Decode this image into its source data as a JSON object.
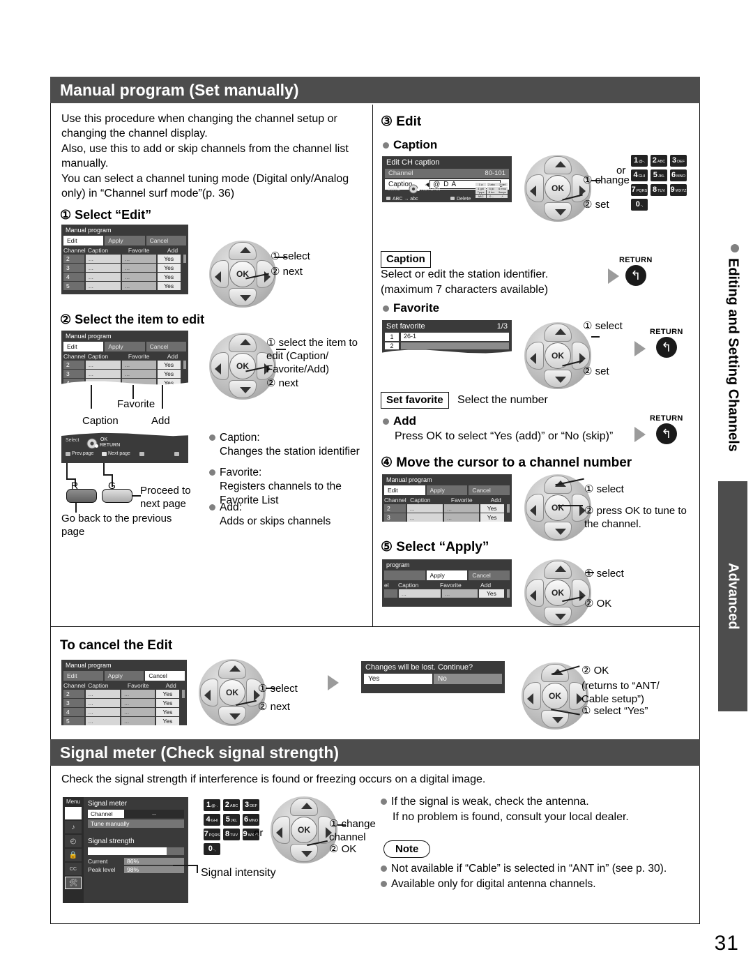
{
  "page_number": "31",
  "side_tabs": {
    "chapter": "Editing and Setting Channels",
    "level": "Advanced"
  },
  "section_manual": {
    "heading": "Manual program (Set manually)",
    "intro": [
      "Use this procedure when changing the channel setup or changing the channel display.",
      "Also, use this to add or skip channels from the channel list manually.",
      "You can select a channel tuning mode (Digital only/Analog only) in “Channel surf mode”(p. 36)"
    ],
    "step1": {
      "title": "① Select “Edit”",
      "screen": {
        "title": "Manual program",
        "tabs": [
          "Edit",
          "Apply",
          "Cancel"
        ],
        "selected_tab": "Edit",
        "columns": [
          "Channel",
          "Caption",
          "Favorite",
          "Add"
        ],
        "rows": [
          {
            "channel": "2",
            "caption": "...",
            "favorite": "...",
            "add": "Yes"
          },
          {
            "channel": "3",
            "caption": "...",
            "favorite": "...",
            "add": "Yes"
          },
          {
            "channel": "4",
            "caption": "...",
            "favorite": "...",
            "add": "Yes"
          },
          {
            "channel": "5",
            "caption": "...",
            "favorite": "...",
            "add": "Yes"
          }
        ]
      },
      "callouts": [
        "① select",
        "② next"
      ]
    },
    "step2": {
      "title": "② Select the item to edit",
      "screen": {
        "title": "Manual program",
        "tabs": [
          "Edit",
          "Apply",
          "Cancel"
        ],
        "selected_tab": "Edit",
        "columns": [
          "Channel",
          "Caption",
          "Favorite",
          "Add"
        ],
        "rows": [
          {
            "channel": "2",
            "caption": "...",
            "favorite": "...",
            "add": "Yes"
          },
          {
            "channel": "3",
            "caption": "...",
            "favorite": "...",
            "add": "Yes"
          },
          {
            "channel": "4",
            "caption": "...",
            "favorite": "...",
            "add": "Yes"
          }
        ]
      },
      "pointer_labels": {
        "caption": "Caption",
        "favorite": "Favorite",
        "add": "Add"
      },
      "callouts": [
        "① select the item to edit (Caption/ Favorite/Add)",
        "② next"
      ],
      "guide_bar": {
        "select": "Select",
        "ok": "OK",
        "return": "RETURN",
        "prev_page": "Prev.page",
        "next_page": "Next page"
      },
      "color_buttons": {
        "r_label": "R",
        "g_label": "G",
        "r_desc": "Go back to the previous page",
        "g_desc": "Proceed to next page"
      },
      "definitions": [
        {
          "term": "Caption:",
          "desc": "Changes the station identifier"
        },
        {
          "term": "Favorite:",
          "desc": "Registers channels to the Favorite List"
        },
        {
          "term": "Add:",
          "desc": "Adds or skips channels"
        }
      ]
    },
    "step3": {
      "title": "③ Edit",
      "caption_sub": "Caption",
      "caption_screen": {
        "title": "Edit CH caption",
        "channel_label": "Channel",
        "channel_value": "80-101",
        "caption_label": "Caption",
        "caption_value": "@ D A",
        "guide_select": "Select",
        "guide_ok": "OK",
        "guide_return": "RETURN",
        "guide_case": "ABC → abc",
        "guide_delete": "Delete"
      },
      "callouts": [
        "① change",
        "② set"
      ],
      "or_label": "or",
      "keypad": [
        {
          "num": "1",
          "sub": "@-."
        },
        {
          "num": "2",
          "sub": "ABC"
        },
        {
          "num": "3",
          "sub": "DEF"
        },
        {
          "num": "4",
          "sub": "GHI"
        },
        {
          "num": "5",
          "sub": "JKL"
        },
        {
          "num": "6",
          "sub": "MNO"
        },
        {
          "num": "7",
          "sub": "PQRS"
        },
        {
          "num": "8",
          "sub": "TUV"
        },
        {
          "num": "9",
          "sub": "WXYZ"
        },
        {
          "num": "0",
          "sub": "-,"
        }
      ],
      "return_label": "RETURN",
      "caption_box": "Caption",
      "caption_desc1": "Select or edit the station identifier.",
      "caption_desc2": "(maximum 7 characters available)",
      "favorite_sub": "Favorite",
      "favorite_screen": {
        "title": "Set favorite",
        "page": "1/3",
        "rows": [
          {
            "index": "1",
            "value": "26-1"
          },
          {
            "index": "2",
            "value": ""
          }
        ]
      },
      "favorite_callouts": [
        "① select",
        "② set"
      ],
      "setfav_box": "Set favorite",
      "setfav_desc": "Select the number",
      "add_sub": "Add",
      "add_desc": "Press OK to select “Yes (add)” or “No (skip)”"
    },
    "step4": {
      "title": "④ Move the cursor to a channel number",
      "screen": {
        "title": "Manual program",
        "tabs": [
          "Edit",
          "Apply",
          "Cancel"
        ],
        "selected_tab": "Edit",
        "columns": [
          "Channel",
          "Caption",
          "Favorite",
          "Add"
        ],
        "rows": [
          {
            "channel": "2",
            "caption": "...",
            "favorite": "...",
            "add": "Yes"
          },
          {
            "channel": "3",
            "caption": "...",
            "favorite": "...",
            "add": "Yes"
          }
        ]
      },
      "callouts": [
        "① select",
        "② press OK to tune to the channel."
      ]
    },
    "step5": {
      "title": "⑤ Select “Apply”",
      "screen": {
        "title": "program",
        "tabs": [
          "",
          "Apply",
          "Cancel"
        ],
        "selected_tab": "Apply",
        "columns": [
          "el",
          "Caption",
          "Favorite",
          "Add"
        ],
        "rows": [
          {
            "channel": "",
            "caption": "...",
            "favorite": "...",
            "add": "Yes"
          }
        ]
      },
      "callouts": [
        "① select",
        "② OK"
      ]
    },
    "cancel": {
      "title": "To cancel the Edit",
      "screen": {
        "title": "Manual program",
        "tabs": [
          "Edit",
          "Apply",
          "Cancel"
        ],
        "selected_tab": "Cancel",
        "columns": [
          "Channel",
          "Caption",
          "Favorite",
          "Add"
        ],
        "rows": [
          {
            "channel": "2",
            "caption": "...",
            "favorite": "...",
            "add": "Yes"
          },
          {
            "channel": "3",
            "caption": "...",
            "favorite": "...",
            "add": "Yes"
          },
          {
            "channel": "4",
            "caption": "...",
            "favorite": "...",
            "add": "Yes"
          },
          {
            "channel": "5",
            "caption": "...",
            "favorite": "...",
            "add": "Yes"
          }
        ]
      },
      "callouts1": [
        "① select",
        "② next"
      ],
      "dialog": {
        "message": "Changes will be lost. Continue?",
        "yes": "Yes",
        "no": "No"
      },
      "callouts2": [
        "② OK",
        "(returns to “ANT/ Cable setup”)",
        "① select “Yes”"
      ]
    }
  },
  "section_signal": {
    "heading": "Signal meter (Check signal strength)",
    "intro": "Check the signal strength if interference is found or freezing occurs on a digital image.",
    "screen": {
      "menu_label": "Menu",
      "title": "Signal meter",
      "channel_label": "Channel",
      "channel_value": "--",
      "tune_manually": "Tune manually",
      "strength_label": "Signal strength",
      "current_label": "Current",
      "current_value": "86%",
      "peak_label": "Peak level",
      "peak_value": "98%",
      "menu_icons": [
        "picture-icon",
        "audio-icon",
        "timer-icon",
        "lock-icon",
        "cc-icon",
        "setup-icon"
      ]
    },
    "keypad": [
      {
        "num": "1",
        "sub": "@-."
      },
      {
        "num": "2",
        "sub": "ABC"
      },
      {
        "num": "3",
        "sub": "DEF"
      },
      {
        "num": "4",
        "sub": "GHI"
      },
      {
        "num": "5",
        "sub": "JKL"
      },
      {
        "num": "6",
        "sub": "MNO"
      },
      {
        "num": "7",
        "sub": "PQRS"
      },
      {
        "num": "8",
        "sub": "TUV"
      },
      {
        "num": "9",
        "sub": "WXYZ"
      },
      {
        "num": "0",
        "sub": "-,"
      }
    ],
    "or_label": "or",
    "callouts": [
      "① change channel",
      "② OK"
    ],
    "intensity_label": "Signal intensity",
    "bullets": [
      "If the signal is weak, check the antenna.",
      "If no problem is found, consult your local dealer."
    ],
    "note_label": "Note",
    "notes": [
      "Not available if “Cable” is selected in “ANT in” (see p. 30).",
      "Available only for digital antenna channels."
    ]
  }
}
